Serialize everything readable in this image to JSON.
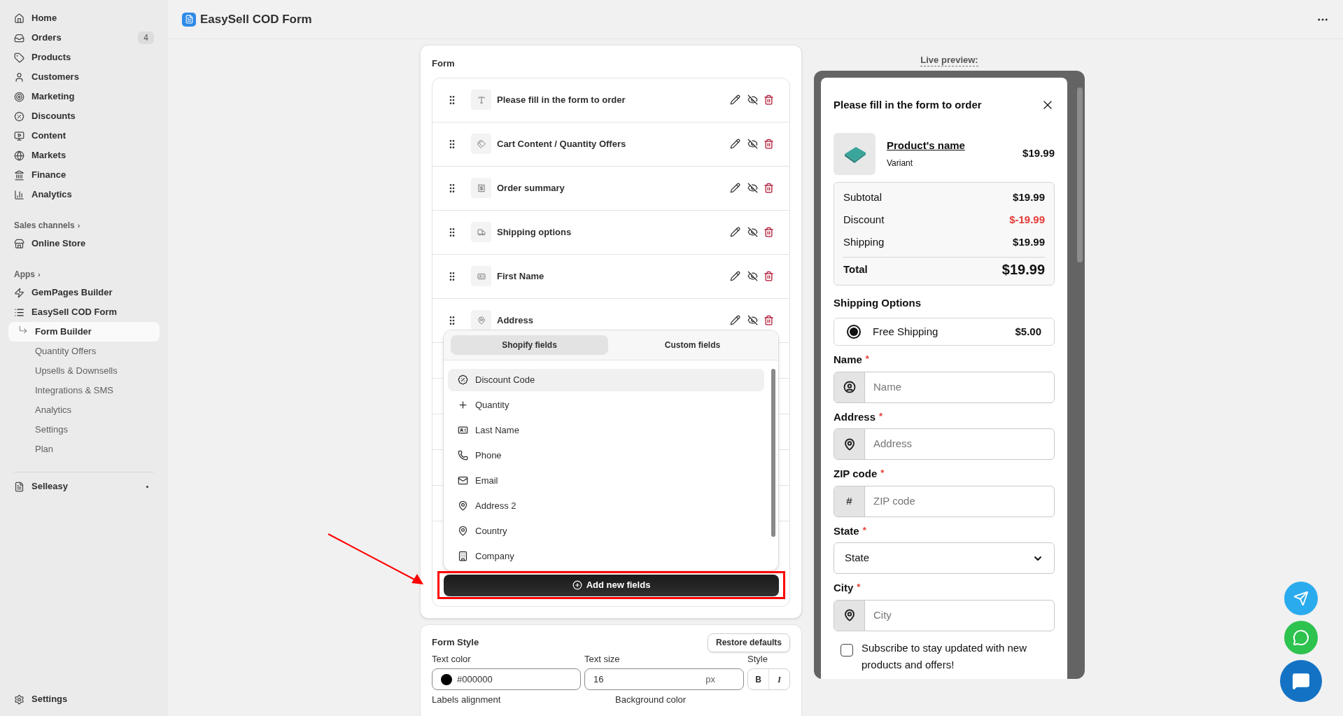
{
  "topbar": {
    "title": "EasySell COD Form"
  },
  "sidebar": {
    "items": [
      {
        "label": "Home"
      },
      {
        "label": "Orders",
        "badge": "4"
      },
      {
        "label": "Products"
      },
      {
        "label": "Customers"
      },
      {
        "label": "Marketing"
      },
      {
        "label": "Discounts"
      },
      {
        "label": "Content"
      },
      {
        "label": "Markets"
      },
      {
        "label": "Finance"
      },
      {
        "label": "Analytics"
      }
    ],
    "sections": [
      {
        "title": "Sales channels",
        "chevron": "›",
        "items": [
          {
            "label": "Online Store"
          }
        ]
      },
      {
        "title": "Apps",
        "chevron": "›",
        "items": [
          {
            "label": "GemPages Builder"
          },
          {
            "label": "EasySell COD Form",
            "children": [
              {
                "label": "Form Builder",
                "selected": true
              },
              {
                "label": "Quantity Offers",
                "selected": false
              },
              {
                "label": "Upsells & Downsells",
                "selected": false
              },
              {
                "label": "Integrations & SMS",
                "selected": false
              },
              {
                "label": "Analytics",
                "selected": false
              },
              {
                "label": "Settings",
                "selected": false
              },
              {
                "label": "Plan",
                "selected": false
              }
            ]
          }
        ]
      }
    ],
    "pinned": {
      "label": "Selleasy"
    },
    "settings": {
      "label": "Settings"
    }
  },
  "form": {
    "title": "Form",
    "rows": [
      {
        "label": "Please fill in the form to order"
      },
      {
        "label": "Cart Content / Quantity Offers"
      },
      {
        "label": "Order summary"
      },
      {
        "label": "Shipping options"
      },
      {
        "label": "First Name"
      },
      {
        "label": "Address"
      }
    ],
    "picker": {
      "tabs": [
        {
          "label": "Shopify fields",
          "selected": true
        },
        {
          "label": "Custom fields",
          "selected": false
        }
      ],
      "items": [
        {
          "label": "Discount Code",
          "highlighted": true
        },
        {
          "label": "Quantity",
          "highlighted": false
        },
        {
          "label": "Last Name",
          "highlighted": false
        },
        {
          "label": "Phone",
          "highlighted": false
        },
        {
          "label": "Email",
          "highlighted": false
        },
        {
          "label": "Address 2",
          "highlighted": false
        },
        {
          "label": "Country",
          "highlighted": false
        },
        {
          "label": "Company",
          "highlighted": false
        }
      ]
    },
    "add_button": "Add new fields"
  },
  "form_style": {
    "title": "Form Style",
    "restore_button": "Restore defaults",
    "text_color": {
      "label": "Text color",
      "value": "#000000"
    },
    "text_size": {
      "label": "Text size",
      "value": "16",
      "unit": "px"
    },
    "style": {
      "label": "Style",
      "bold": "B",
      "italic": "I"
    },
    "labels_alignment": {
      "label": "Labels alignment"
    },
    "background_color": {
      "label": "Background color"
    }
  },
  "preview": {
    "heading": "Live preview:",
    "title": "Please fill in the form to order",
    "product": {
      "name": "Product's name",
      "variant": "Variant",
      "price": "$19.99"
    },
    "summary": [
      {
        "label": "Subtotal",
        "value": "$19.99",
        "kind": "normal"
      },
      {
        "label": "Discount",
        "value": "$-19.99",
        "kind": "discount"
      },
      {
        "label": "Shipping",
        "value": "$19.99",
        "kind": "normal"
      }
    ],
    "total": {
      "label": "Total",
      "value": "$19.99"
    },
    "shipping": {
      "title": "Shipping Options",
      "options": [
        {
          "label": "Free Shipping",
          "price": "$5.00",
          "selected": true
        }
      ]
    },
    "fields": [
      {
        "label": "Name",
        "required_mark": "*",
        "kind": "icon_input",
        "placeholder": "Name"
      },
      {
        "label": "Address",
        "required_mark": "*",
        "kind": "icon_input",
        "placeholder": "Address"
      },
      {
        "label": "ZIP code",
        "required_mark": "*",
        "kind": "text_prefix_input",
        "prefix": "#",
        "placeholder": "ZIP code"
      },
      {
        "label": "State",
        "required_mark": "*",
        "kind": "select",
        "value": "State"
      },
      {
        "label": "City",
        "required_mark": "*",
        "kind": "icon_input",
        "placeholder": "City"
      }
    ],
    "subscribe": {
      "label": "Subscribe to stay updated with new products and offers!",
      "checked": false
    }
  }
}
